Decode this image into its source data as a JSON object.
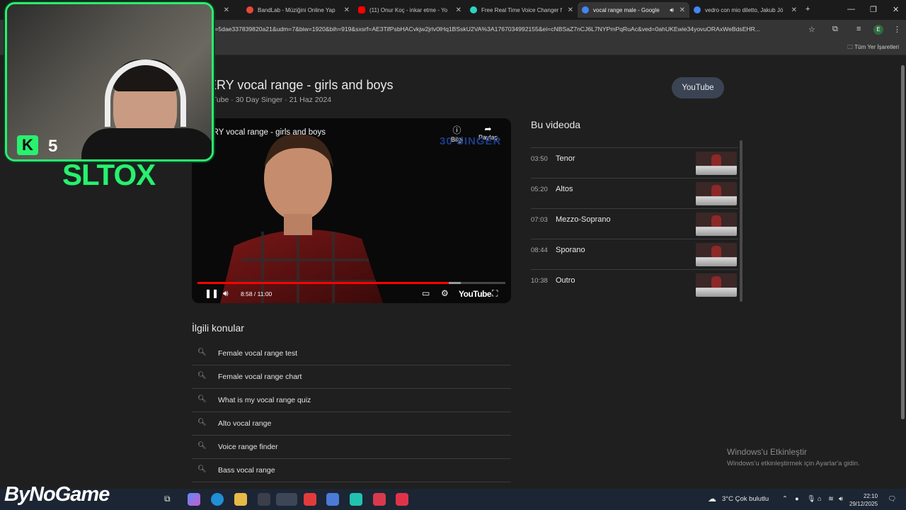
{
  "browser": {
    "tabs": [
      {
        "label": "BandLab - Müziğini Online Yap",
        "fav_color": "#e8483b"
      },
      {
        "label": "(11) Onur Koç - inkar etme - Yo",
        "fav_color": "#ff0000"
      },
      {
        "label": "Free Real Time Voice Changer f",
        "fav_color": "#2dd4bf"
      },
      {
        "label": "vocal range male - Google",
        "fav_color": "#4285f4"
      },
      {
        "label": "vedro con mio diletto, Jakub Jó",
        "fav_color": "#4285f4"
      }
    ],
    "new_tab": "+",
    "url": "esv=5dae337839820a21&udm=7&biw=1920&bih=919&sxsrf=AE3TifPsbHACvkjw2jrlv0lHq1BSskU2VA%3A1767034992155&ei=cNBSaZ7nCJ6L7NYPmPqRuAc&ved=0ahUKEwie34yovuORAxWeBdsEHR...",
    "bookmarks_all": "Tüm Yer İşaretleri"
  },
  "video": {
    "title": "ERY vocal range - girls and boys",
    "meta": "uTube · 30 Day Singer · 21 Haz 2024",
    "source_pill": "YouTube",
    "player_title": "ERY vocal range - girls and boys",
    "info_label": "Bilgi",
    "share_label": "Paylaş",
    "brand": "30 SINGER",
    "time": "8:58 / 11:00",
    "progress_played": 0.815,
    "progress_loaded": 0.855,
    "yt_logo": "YouTube"
  },
  "chapters": {
    "heading": "Bu videoda",
    "items": [
      {
        "time": "03:50",
        "name": "Tenor"
      },
      {
        "time": "05:20",
        "name": "Altos"
      },
      {
        "time": "07:03",
        "name": "Mezzo-Soprano"
      },
      {
        "time": "08:44",
        "name": "Sporano"
      },
      {
        "time": "10:38",
        "name": "Outro"
      }
    ]
  },
  "related": {
    "heading": "İlgili konular",
    "items": [
      "Female vocal range test",
      "Female vocal range chart",
      "What is my vocal range quiz",
      "Alto vocal range",
      "Voice range finder",
      "Bass vocal range"
    ]
  },
  "activation": {
    "title": "Windows'u Etkinleştir",
    "subtitle": "Windows'u etkinleştirmek için Ayarlar'a gidin."
  },
  "overlay": {
    "streamer_name": "SLTOX",
    "kick_letter": "K",
    "kick_count": "5",
    "sponsor": "ByNoGame"
  },
  "taskbar": {
    "weather": "3°C  Çok bulutlu",
    "time": "22:10",
    "date": "29/12/2025"
  }
}
